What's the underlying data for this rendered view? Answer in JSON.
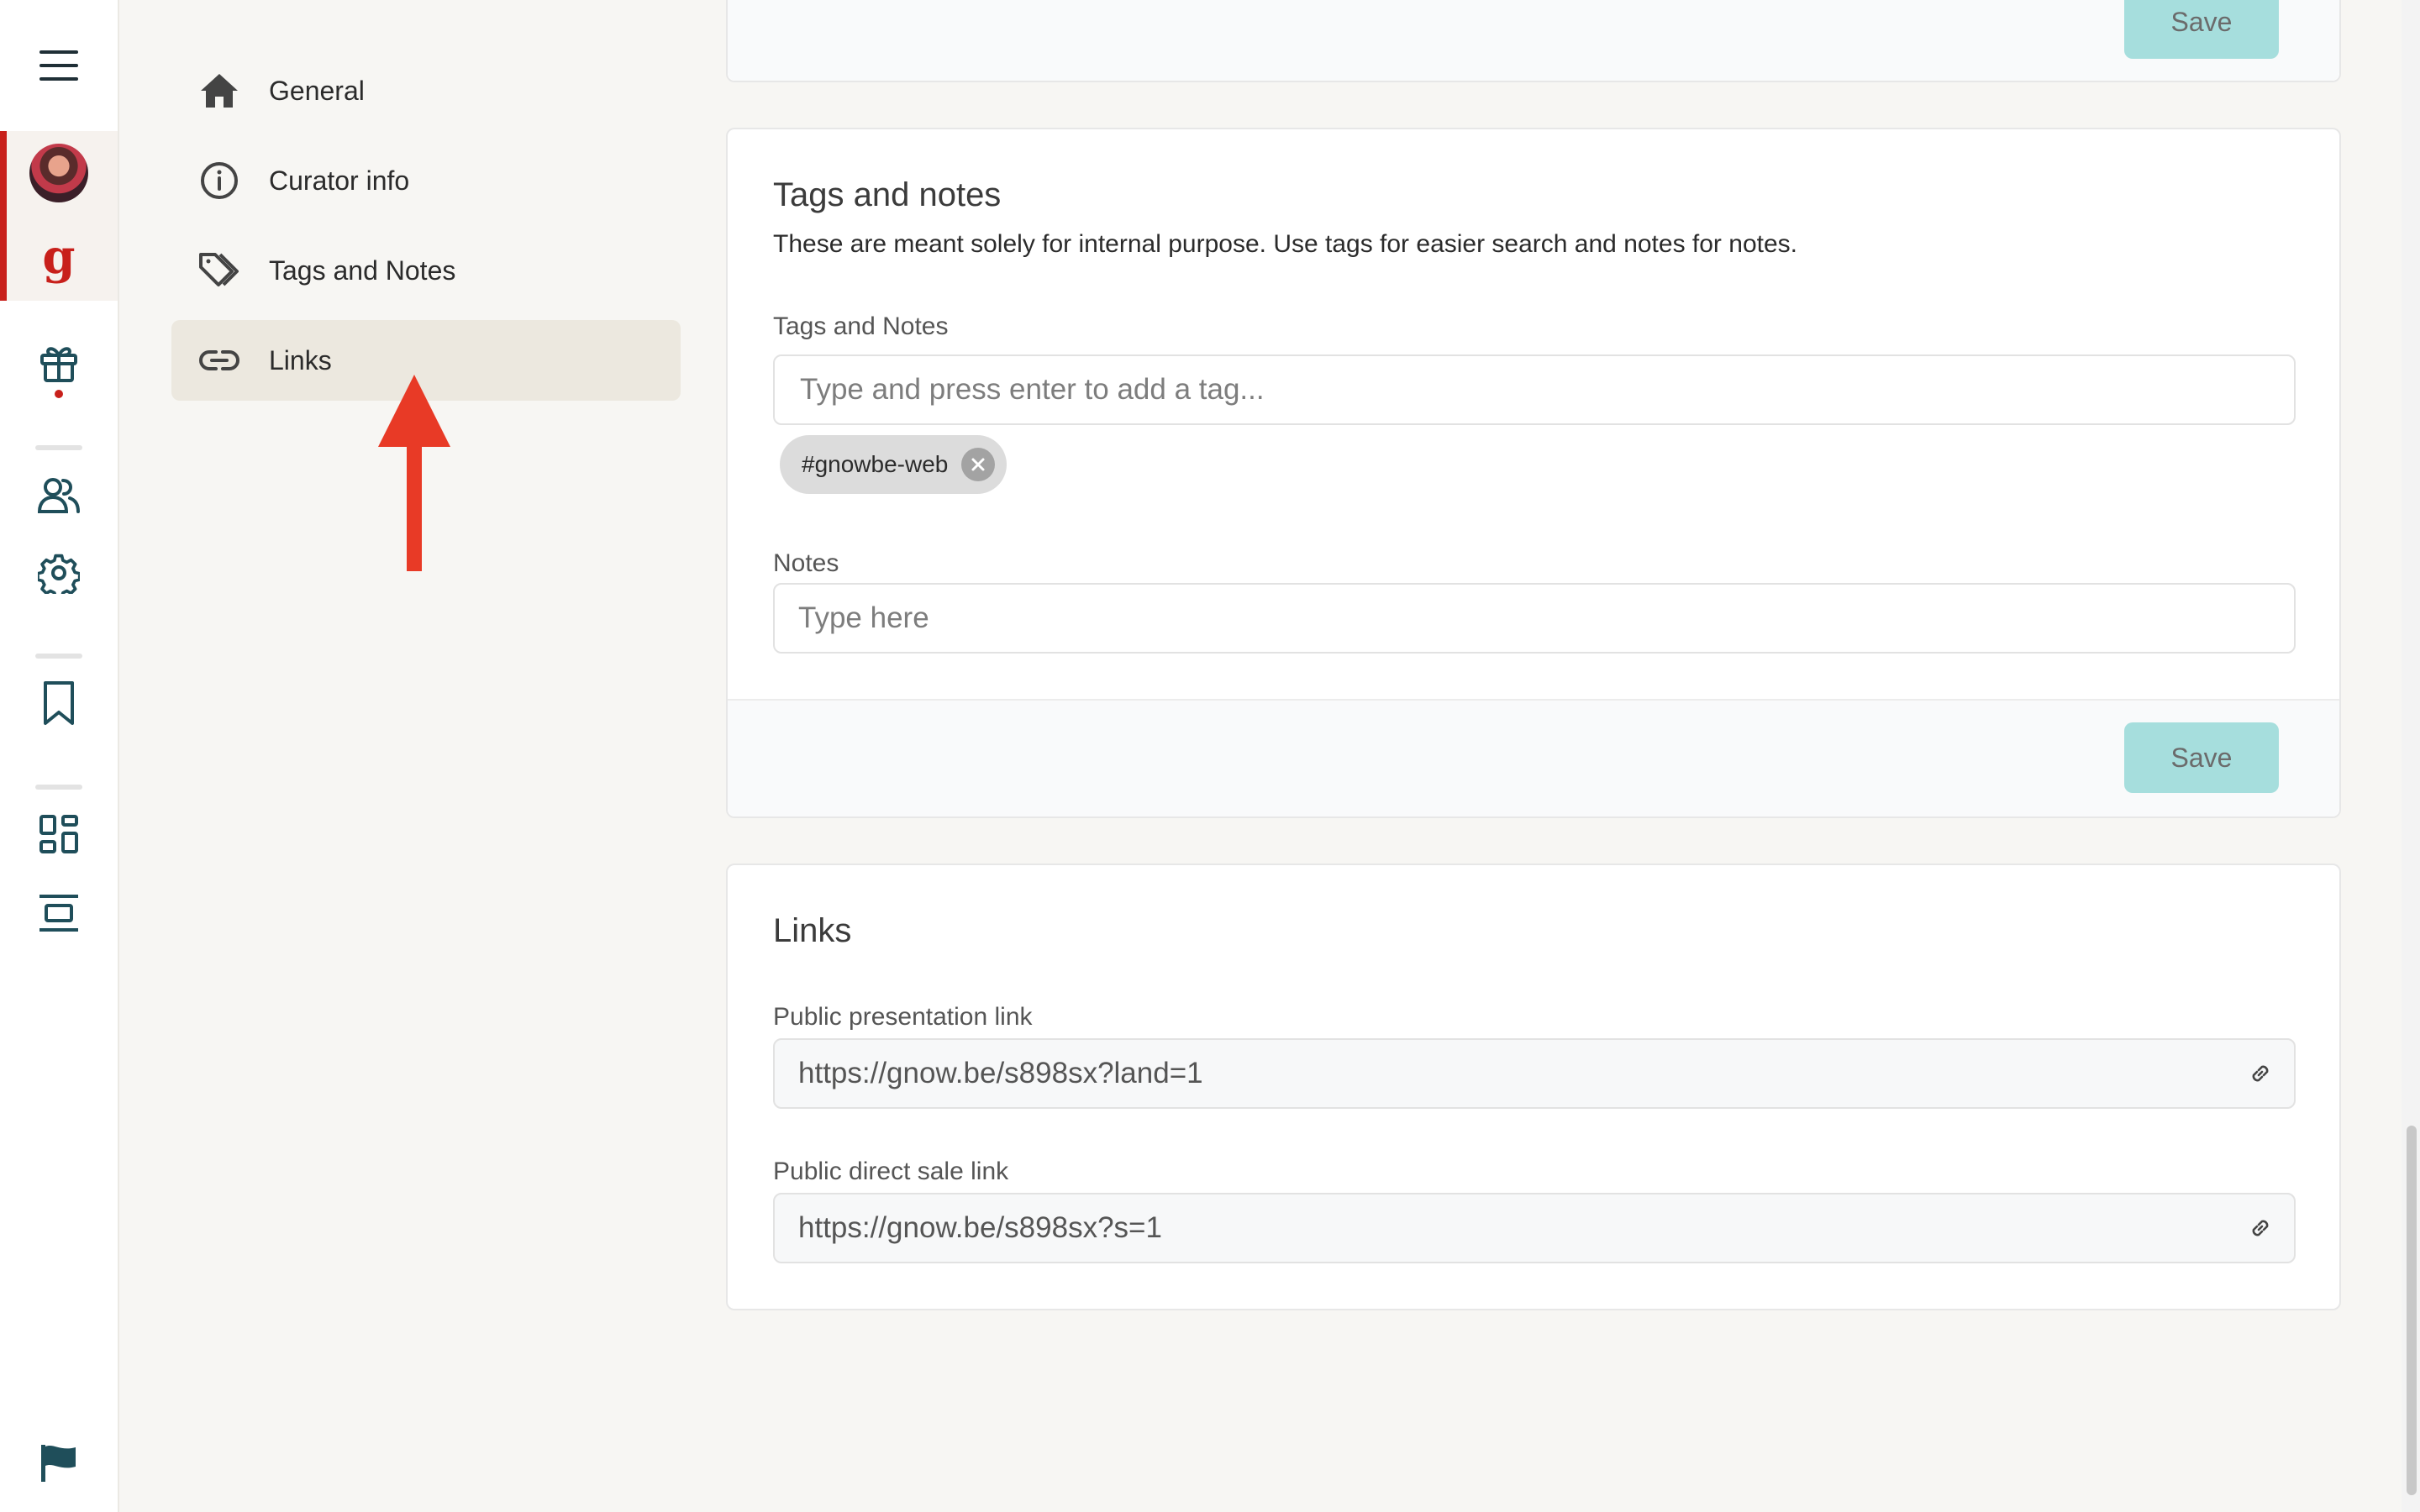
{
  "rail": {
    "menu_icon": "hamburger-menu-icon",
    "logo_letter": "g",
    "icons": [
      "gift-icon",
      "users-icon",
      "settings-gear-icon",
      "bookmark-icon",
      "dashboard-grid-icon",
      "layout-icon",
      "flag-icon"
    ],
    "accent_color": "#c8201b",
    "icon_color": "#1f4e5a"
  },
  "subnav": {
    "items": [
      {
        "label": "General",
        "icon": "home-icon"
      },
      {
        "label": "Curator info",
        "icon": "info-icon"
      },
      {
        "label": "Tags and Notes",
        "icon": "tag-icon"
      },
      {
        "label": "Links",
        "icon": "link-icon",
        "active": true
      }
    ]
  },
  "annotation": {
    "icon": "red-arrow-up-icon",
    "color": "#e83a26"
  },
  "top_card": {
    "save_label": "Save"
  },
  "tags_card": {
    "title": "Tags and notes",
    "description": "These are meant solely for internal purpose. Use tags for easier search and notes for notes.",
    "tags_label": "Tags and Notes",
    "tags_placeholder": "Type and press enter to add a tag...",
    "tags": [
      "#gnowbe-web"
    ],
    "notes_label": "Notes",
    "notes_placeholder": "Type here",
    "save_label": "Save",
    "save_color": "#a6dedd"
  },
  "links_card": {
    "title": "Links",
    "presentation_label": "Public presentation link",
    "presentation_value": "https://gnow.be/s898sx?land=1",
    "sale_label": "Public direct sale link",
    "sale_value": "https://gnow.be/s898sx?s=1"
  }
}
